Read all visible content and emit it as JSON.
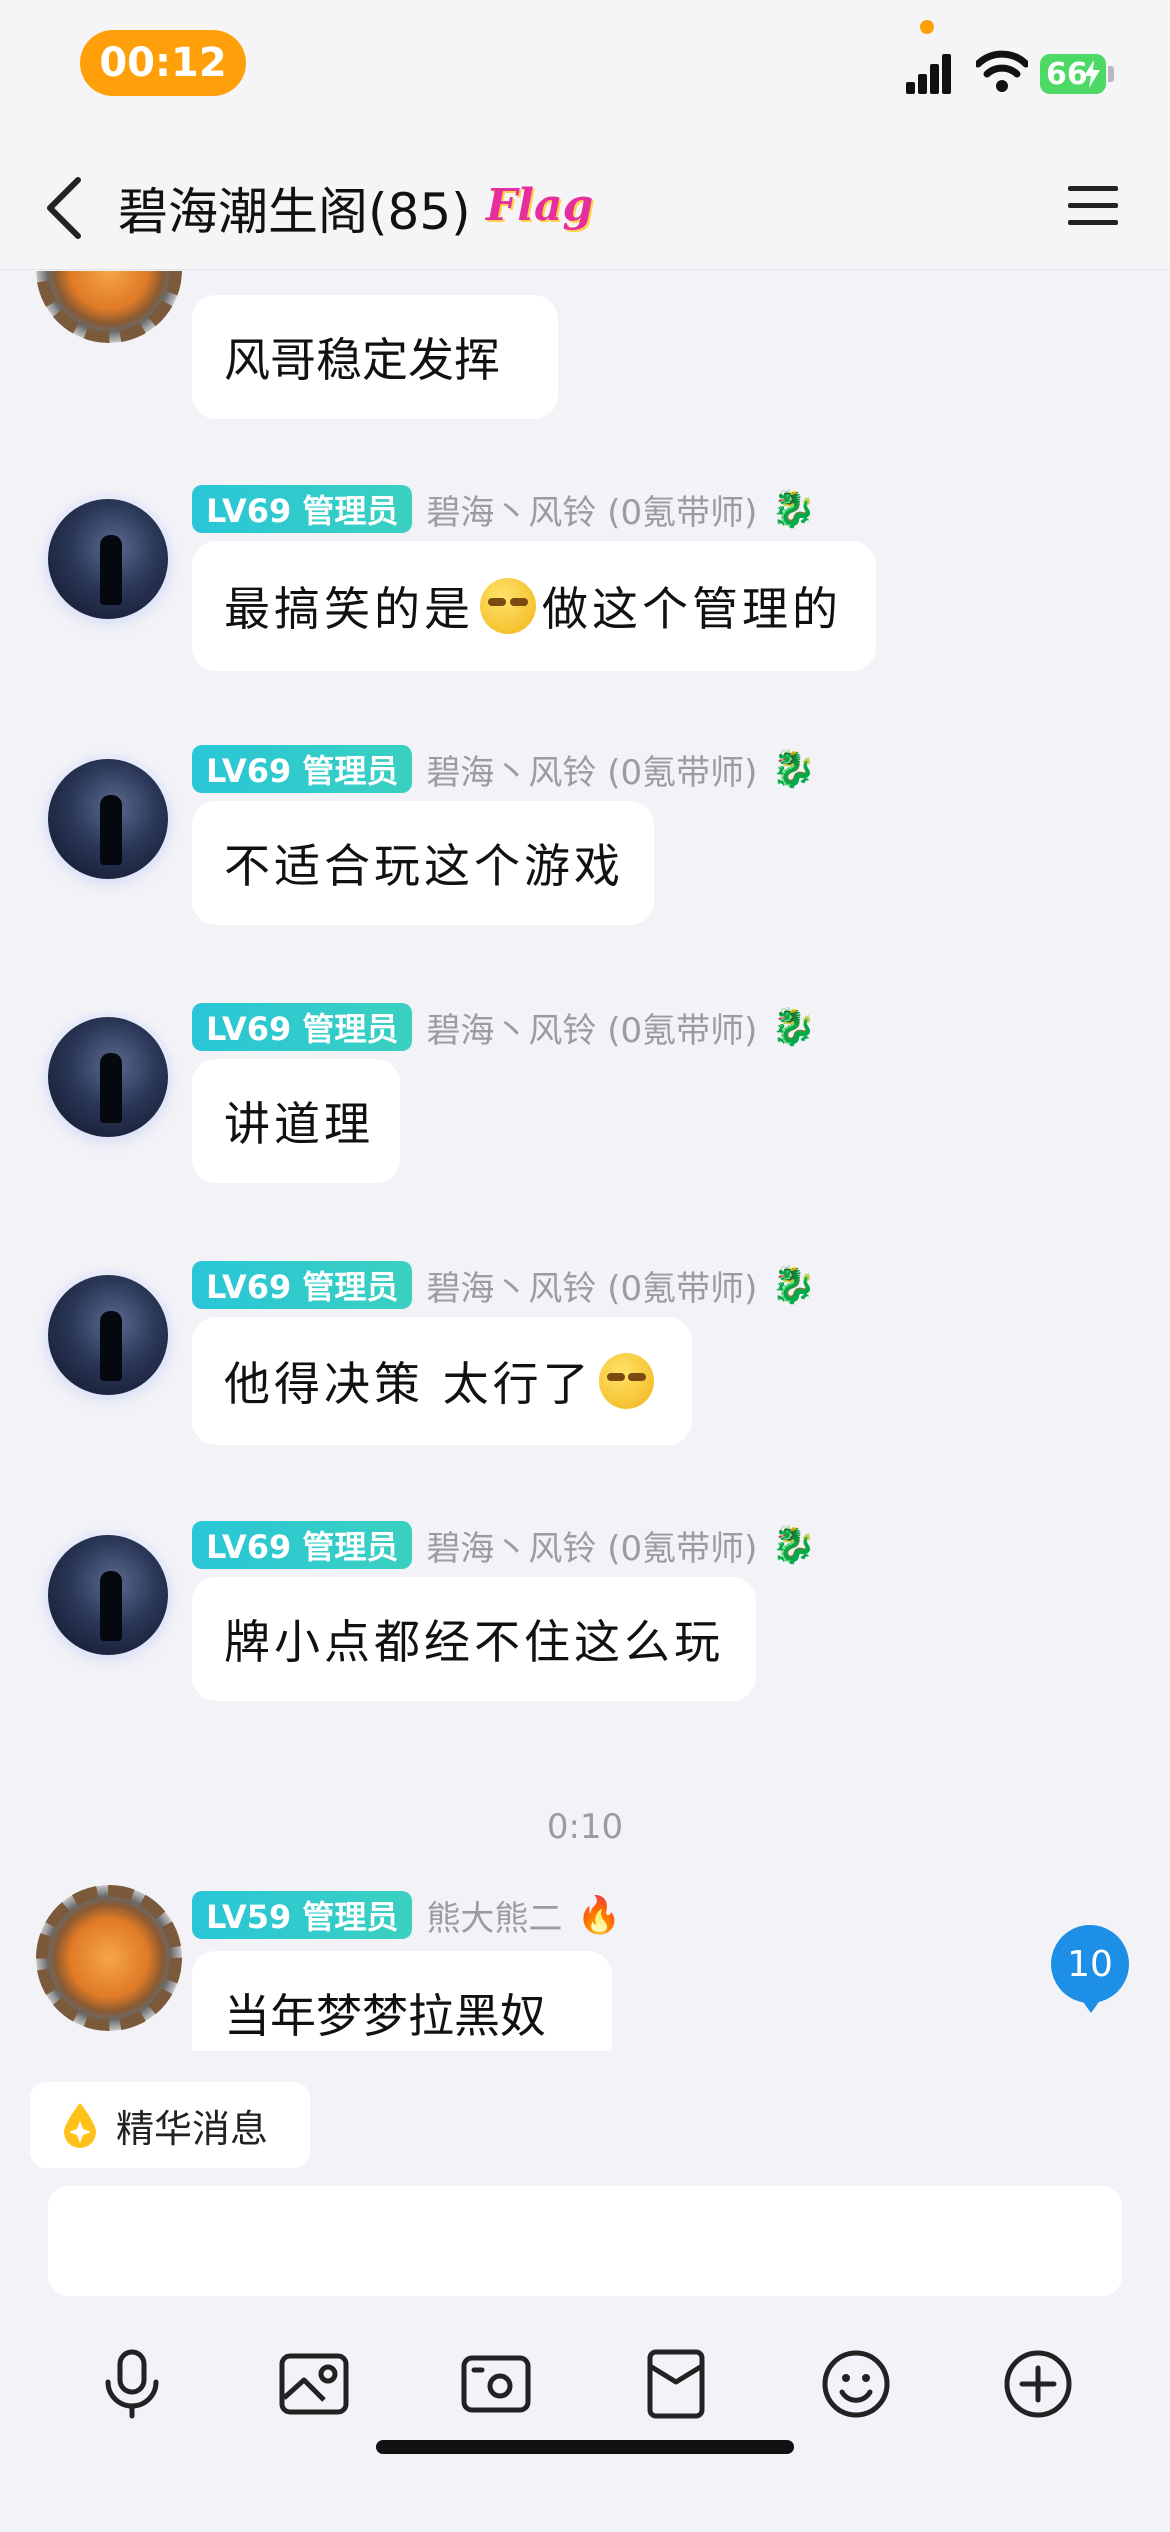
{
  "status_bar": {
    "time": "00:12",
    "battery": "66"
  },
  "nav": {
    "title": "碧海潮生阁(85)",
    "flag": "Flag"
  },
  "messages": [
    {
      "sender": "",
      "level": "",
      "text": "风哥稳定发挥",
      "emoji": false
    },
    {
      "sender": "碧海丶风铃 (0氪带师)",
      "level": "LV69 管理员",
      "text_before": "最搞笑的是",
      "text_after": "做这个管理的",
      "emoji": true
    },
    {
      "sender": "碧海丶风铃 (0氪带师)",
      "level": "LV69 管理员",
      "text": "不适合玩这个游戏",
      "emoji": false
    },
    {
      "sender": "碧海丶风铃 (0氪带师)",
      "level": "LV69 管理员",
      "text": "讲道理",
      "emoji": false
    },
    {
      "sender": "碧海丶风铃 (0氪带师)",
      "level": "LV69 管理员",
      "text": "他得决策 太行了",
      "emoji": true
    },
    {
      "sender": "碧海丶风铃 (0氪带师)",
      "level": "LV69 管理员",
      "text": "牌小点都经不住这么玩",
      "emoji": false
    },
    {
      "sender": "熊大熊二",
      "level": "LV59 管理员",
      "text": "当年梦梦拉黑奴",
      "emoji": false
    }
  ],
  "timestamp": "0:10",
  "unread_count": "10",
  "bottom": {
    "essence_label": "精华消息"
  },
  "toolbar_icons": [
    "microphone-icon",
    "image-icon",
    "camera-icon",
    "red-packet-icon",
    "emoji-icon",
    "plus-icon"
  ],
  "colors": {
    "accent": "#1e8fe6",
    "level_badge": "#29c6d8",
    "time_pill": "#ff9f0a",
    "battery": "#4cd964"
  }
}
